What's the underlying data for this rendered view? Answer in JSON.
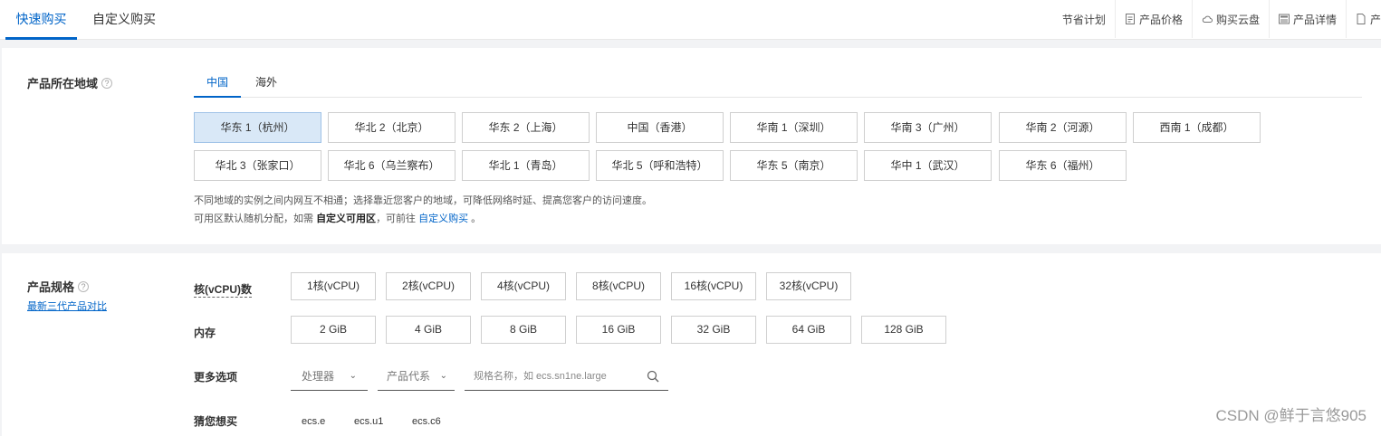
{
  "tabs": [
    {
      "label": "快速购买",
      "active": true
    },
    {
      "label": "自定义购买",
      "active": false
    }
  ],
  "tools": [
    {
      "label": "节省计划",
      "icon": ""
    },
    {
      "label": "产品价格",
      "icon": "price-doc-icon"
    },
    {
      "label": "购买云盘",
      "icon": "cloud-icon"
    },
    {
      "label": "产品详情",
      "icon": "detail-icon"
    },
    {
      "label": "产",
      "icon": "doc-icon"
    }
  ],
  "region": {
    "title": "产品所在地域",
    "tabs": [
      {
        "label": "中国",
        "active": true
      },
      {
        "label": "海外",
        "active": false
      }
    ],
    "buttons": [
      [
        "华东 1（杭州）",
        "华北 2（北京）",
        "华东 2（上海）",
        "中国（香港）",
        "华南 1（深圳）",
        "华南 3（广州）",
        "华南 2（河源）",
        "西南 1（成都）"
      ],
      [
        "华北 3（张家口）",
        "华北 6（乌兰察布）",
        "华北 1（青岛）",
        "华北 5（呼和浩特）",
        "华东 5（南京）",
        "华中 1（武汉）",
        "华东 6（福州）"
      ]
    ],
    "selected": "华东 1（杭州）",
    "hint1": "不同地域的实例之间内网互不相通；选择靠近您客户的地域，可降低网络时延、提高您客户的访问速度。",
    "hint2_prefix": "可用区默认随机分配，如需 ",
    "hint2_bold": "自定义可用区",
    "hint2_mid": "，可前往 ",
    "hint2_link": "自定义购买",
    "hint2_suffix": " 。"
  },
  "spec": {
    "title": "产品规格",
    "compare_link": "最新三代产品对比",
    "cpu_label": "核(vCPU)数",
    "cpu_options": [
      "1核(vCPU)",
      "2核(vCPU)",
      "4核(vCPU)",
      "8核(vCPU)",
      "16核(vCPU)",
      "32核(vCPU)"
    ],
    "mem_label": "内存",
    "mem_options": [
      "2 GiB",
      "4 GiB",
      "8 GiB",
      "16 GiB",
      "32 GiB",
      "64 GiB",
      "128 GiB"
    ],
    "more_label": "更多选项",
    "processor_placeholder": "处理器",
    "family_placeholder": "产品代系",
    "search_placeholder": "规格名称，如 ecs.sn1ne.large",
    "guess_label": "猜您想买",
    "guess_items": [
      "ecs.e",
      "ecs.u1",
      "ecs.c6"
    ]
  },
  "watermark": "CSDN @鲜于言悠905",
  "colors": {
    "accent": "#0064c8",
    "selected_bg": "#d9e8f7"
  }
}
